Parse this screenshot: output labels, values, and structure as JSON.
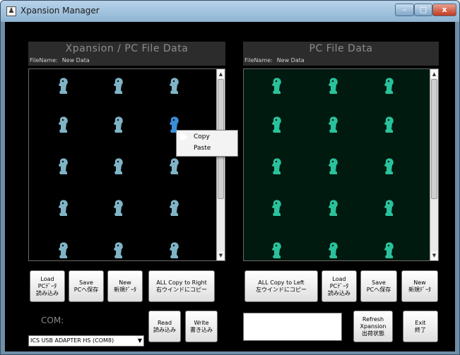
{
  "window": {
    "title": "Xpansion Manager",
    "close_glyph": "x"
  },
  "left_panel": {
    "title": "Xpansion / PC File Data",
    "filename_label": "FileName:",
    "filename_value": "New Data",
    "figure_color": "#7fb4c6",
    "selected_color": "#3a8fd8"
  },
  "right_panel": {
    "title": "PC File Data",
    "filename_label": "FileName:",
    "filename_value": "New Data",
    "figure_color": "#29c29a"
  },
  "context_menu": {
    "items": [
      "Copy",
      "Paste"
    ]
  },
  "buttons": {
    "left_load": [
      "Load",
      "PCﾃﾞｰﾀ",
      "読み込み"
    ],
    "left_save": [
      "Save",
      "PCへ保存"
    ],
    "left_new": [
      "New",
      "新規ﾃﾞｰﾀ"
    ],
    "copy_right": [
      "ALL Copy to Right",
      "右ウインドにコピー"
    ],
    "read": [
      "Read",
      "読み込み"
    ],
    "write": [
      "Write",
      "書き込み"
    ],
    "copy_left": [
      "ALL Copy to Left",
      "左ウインドにコピー"
    ],
    "right_load": [
      "Load",
      "PCﾃﾞｰﾀ",
      "読み込み"
    ],
    "right_save": [
      "Save",
      "PCへ保存"
    ],
    "right_new": [
      "New",
      "新規ﾃﾞｰﾀ"
    ],
    "refresh": [
      "Refresh",
      "Xpansion",
      "出荷状態"
    ],
    "exit": [
      "Exit",
      "終了"
    ]
  },
  "com": {
    "label": "COM:",
    "selected": "ICS USB ADAPTER HS (COM8)"
  }
}
